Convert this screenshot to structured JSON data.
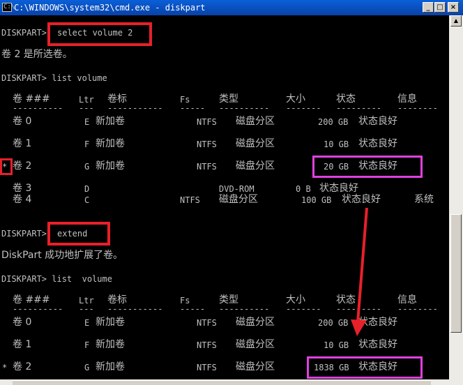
{
  "window": {
    "title": "C:\\WINDOWS\\system32\\cmd.exe - diskpart",
    "icon_label": "C:\\",
    "buttons": {
      "minimize": "_",
      "maximize": "□",
      "close": "×"
    }
  },
  "console": {
    "cmd1_prompt": "DISKPART>",
    "cmd1_text": "select volume 2",
    "msg1": "卷 2 是所选卷。",
    "cmd2": "DISKPART> list volume",
    "cmd3_prompt": "DISKPART>",
    "cmd3_text": "extend",
    "msg2": "DiskPart 成功地扩展了卷。",
    "cmd4": "DISKPART> list  volume"
  },
  "table1": {
    "headers": {
      "vol": "卷 ###",
      "ltr": "Ltr",
      "label": "卷标",
      "fs": "Fs",
      "type": "类型",
      "size": "大小",
      "status": "状态",
      "info": "信息"
    },
    "dashes": {
      "vol": "----------",
      "ltr": "---",
      "label": "-----------",
      "fs": "-----",
      "type": "----------",
      "size": "-------",
      "status": "---------",
      "info": "--------"
    },
    "rows": [
      {
        "marker": "",
        "vol": "卷 0",
        "ltr": "E",
        "label": "新加卷",
        "fs": "NTFS",
        "type": "磁盘分区",
        "size": "200 GB",
        "status": "状态良好",
        "info": ""
      },
      {
        "marker": "",
        "vol": "卷 1",
        "ltr": "F",
        "label": "新加卷",
        "fs": "NTFS",
        "type": "磁盘分区",
        "size": "10 GB",
        "status": "状态良好",
        "info": ""
      },
      {
        "marker": "*",
        "vol": "卷 2",
        "ltr": "G",
        "label": "新加卷",
        "fs": "NTFS",
        "type": "磁盘分区",
        "size": "20 GB",
        "status": "状态良好",
        "info": ""
      },
      {
        "marker": "",
        "vol": "卷 3",
        "ltr": "D",
        "label": "",
        "fs": "",
        "type": "DVD-ROM",
        "size": "0 B",
        "status": "状态良好",
        "info": ""
      },
      {
        "marker": "",
        "vol": "卷 4",
        "ltr": "C",
        "label": "",
        "fs": "NTFS",
        "type": "磁盘分区",
        "size": "100 GB",
        "status": "状态良好",
        "info": "系统"
      }
    ]
  },
  "table2": {
    "rows": [
      {
        "marker": "",
        "vol": "卷 0",
        "ltr": "E",
        "label": "新加卷",
        "fs": "NTFS",
        "type": "磁盘分区",
        "size": "200 GB",
        "status": "状态良好"
      },
      {
        "marker": "",
        "vol": "卷 1",
        "ltr": "F",
        "label": "新加卷",
        "fs": "NTFS",
        "type": "磁盘分区",
        "size": "10 GB",
        "status": "状态良好"
      },
      {
        "marker": "*",
        "vol": "卷 2",
        "ltr": "G",
        "label": "新加卷",
        "fs": "NTFS",
        "type": "磁盘分区",
        "size": "1838 GB",
        "status": "状态良好"
      }
    ]
  },
  "scrollbar": {
    "up_arrow": "▲"
  },
  "colors": {
    "console_bg": "#000000",
    "console_text": "#c0c0c0",
    "highlight_red": "#e8202a",
    "highlight_magenta": "#e040e0",
    "titlebar": "#0a5fd8"
  }
}
